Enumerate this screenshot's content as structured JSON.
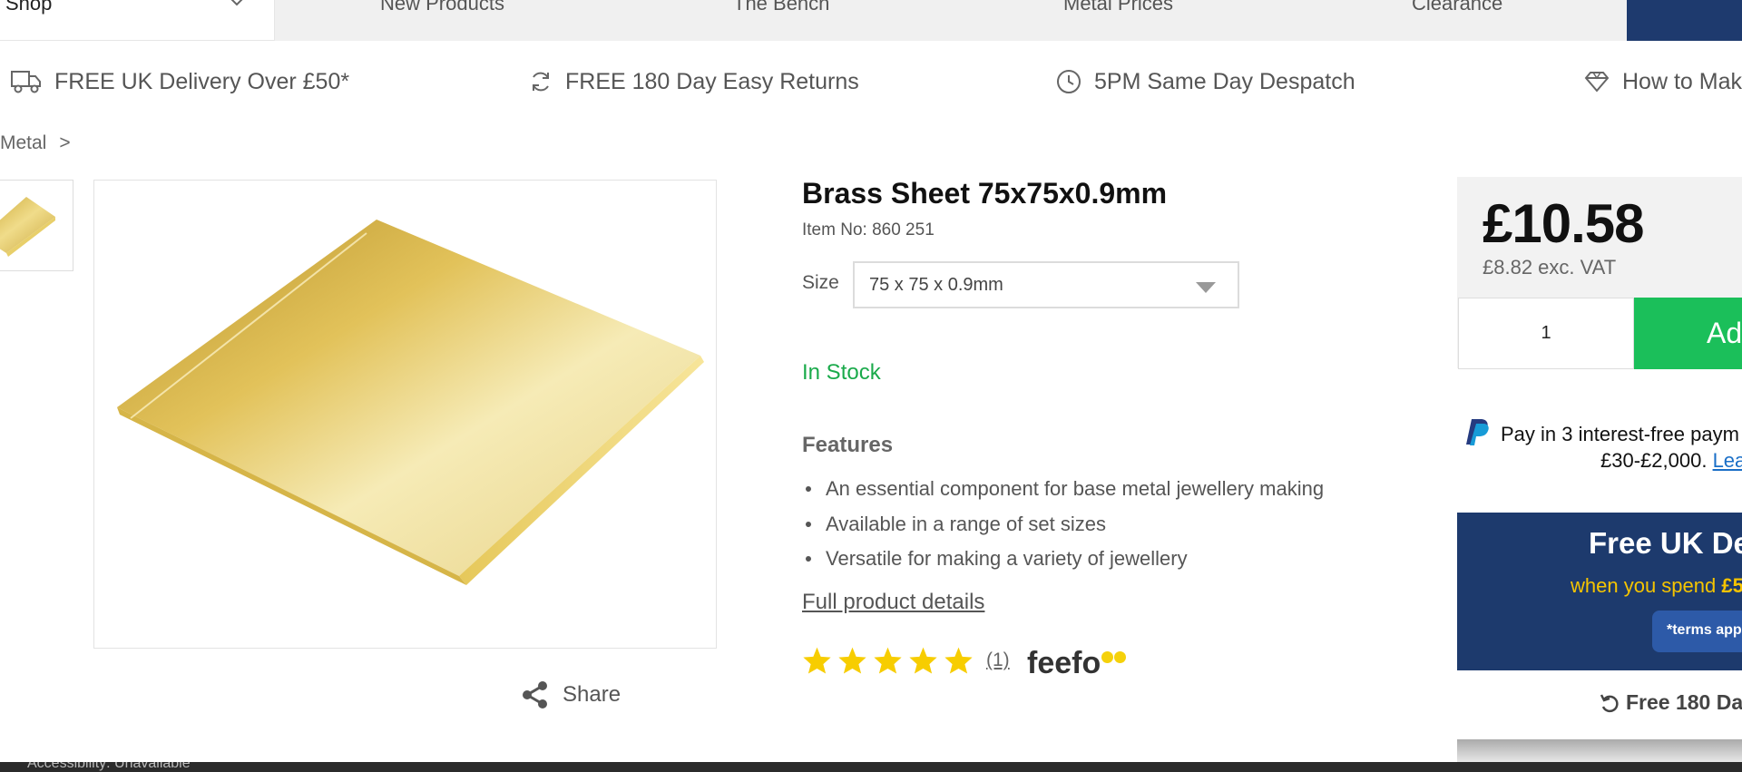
{
  "nav": {
    "shop_label": "Shop",
    "items": [
      "New Products",
      "The Bench",
      "Metal Prices",
      "Clearance"
    ]
  },
  "usp": {
    "delivery": "FREE UK Delivery Over £50*",
    "returns": "FREE 180 Day Easy Returns",
    "despatch": "5PM Same Day Despatch",
    "how_to": "How to Mak"
  },
  "breadcrumb": {
    "current": "Metal",
    "separator": ">"
  },
  "product": {
    "title": "Brass Sheet 75x75x0.9mm",
    "item_no": "Item No: 860 251",
    "size_label": "Size",
    "size_value": "75 x 75 x 0.9mm",
    "stock": "In Stock",
    "features_heading": "Features",
    "features": [
      "An essential component for base metal jewellery making",
      "Available in a range of set sizes",
      "Versatile for making a variety of jewellery"
    ],
    "full_details_link": "Full product details",
    "rating_stars": 5,
    "rating_count": "(1)",
    "review_brand": "feefo",
    "share_label": "Share"
  },
  "buy": {
    "price": "£10.58",
    "ex_vat": "£8.82 exc. VAT",
    "quantity": "1",
    "add_label": "Add",
    "paypal_line1": "Pay in 3 interest-free paym",
    "paypal_line2": "£30-£2,000.",
    "paypal_link": "Lea",
    "promo_title": "Free UK De",
    "promo_sub_prefix": "when you spend ",
    "promo_sub_amount": "£5",
    "promo_terms": "*terms app",
    "returns_label": "Free 180 Da"
  },
  "status": {
    "text": "Accessibility: Unavailable"
  },
  "colors": {
    "accent_navy": "#1d3a6d",
    "stock_green": "#1aaa4b",
    "add_green": "#1bbf5a",
    "star_yellow": "#f7cd00",
    "brass": "#d9b84a"
  }
}
